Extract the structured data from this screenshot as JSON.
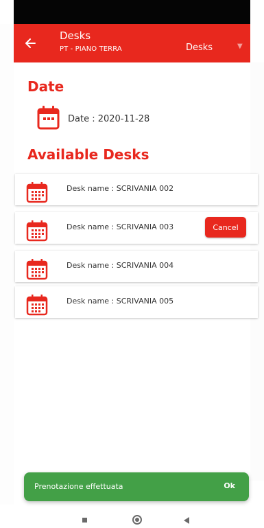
{
  "header": {
    "title": "Desks",
    "subtitle": "PT - PIANO TERRA",
    "dropdown_value": "Desks"
  },
  "date_section": {
    "heading": "Date",
    "label": "Date : 2020-11-28"
  },
  "desks_section": {
    "heading": "Available Desks",
    "items": [
      {
        "label": "Desk name : SCRIVANIA 002"
      },
      {
        "label": "Desk name : SCRIVANIA 003",
        "action": "Cancel"
      },
      {
        "label": "Desk name : SCRIVANIA 004"
      },
      {
        "label": "Desk name : SCRIVANIA 005"
      }
    ]
  },
  "snackbar": {
    "message": "Prenotazione effettuata",
    "action": "Ok"
  },
  "colors": {
    "primary": "#e8281e",
    "success": "#43a047",
    "statusbar": "#050505"
  },
  "icons": [
    "back-arrow-icon",
    "calendar-icon",
    "chevron-down-icon",
    "nav-recents-icon",
    "nav-home-icon",
    "nav-back-icon"
  ]
}
